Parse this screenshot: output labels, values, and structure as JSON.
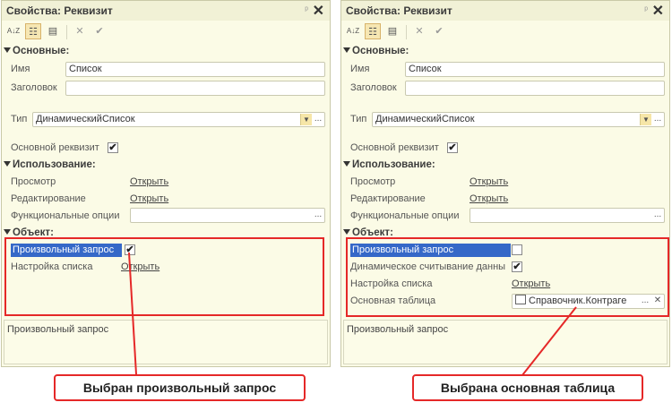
{
  "left": {
    "title": "Свойства: Реквизит",
    "sections": {
      "main": "Основные:",
      "usage": "Использование:",
      "object": "Объект:"
    },
    "name_label": "Имя",
    "name_value": "Список",
    "caption_label": "Заголовок",
    "caption_value": "",
    "type_label": "Тип",
    "type_value": "ДинамическийСписок",
    "main_attr_label": "Основной реквизит",
    "main_attr_checked": "✔",
    "view_label": "Просмотр",
    "view_link": "Открыть",
    "edit_label": "Редактирование",
    "edit_link": "Открыть",
    "func_label": "Функциональные опции",
    "custom_query_label": "Произвольный запрос",
    "custom_query_checked": "✔",
    "list_settings_label": "Настройка списка",
    "list_settings_link": "Открыть",
    "description": "Произвольный запрос"
  },
  "right": {
    "title": "Свойства: Реквизит",
    "sections": {
      "main": "Основные:",
      "usage": "Использование:",
      "object": "Объект:"
    },
    "name_label": "Имя",
    "name_value": "Список",
    "caption_label": "Заголовок",
    "caption_value": "",
    "type_label": "Тип",
    "type_value": "ДинамическийСписок",
    "main_attr_label": "Основной реквизит",
    "main_attr_checked": "✔",
    "view_label": "Просмотр",
    "view_link": "Открыть",
    "edit_label": "Редактирование",
    "edit_link": "Открыть",
    "func_label": "Функциональные опции",
    "custom_query_label": "Произвольный запрос",
    "dynamic_read_label": "Динамическое считывание данны",
    "dynamic_read_checked": "✔",
    "list_settings_label": "Настройка списка",
    "list_settings_link": "Открыть",
    "main_table_label": "Основная таблица",
    "main_table_value": "Справочник.Контраге",
    "description": "Произвольный запрос"
  },
  "toolbar_icons": [
    "sort-az-icon",
    "categories-icon",
    "filter-icon",
    "close-icon",
    "check-icon"
  ],
  "glyphs": {
    "pin": "ᵖ",
    "close": "✕",
    "dropdown": "▼",
    "ellipsis": "...",
    "clear": "✕",
    "sort": "A↓Z",
    "cat": "☷",
    "filter": "▤",
    "x": "✕",
    "check": "✔"
  },
  "callouts": {
    "left": "Выбран произвольный запрос",
    "right": "Выбрана основная таблица"
  },
  "colors": {
    "highlight": "#e52828",
    "selection": "#3568c8",
    "panel_bg": "#fbfbe6"
  }
}
